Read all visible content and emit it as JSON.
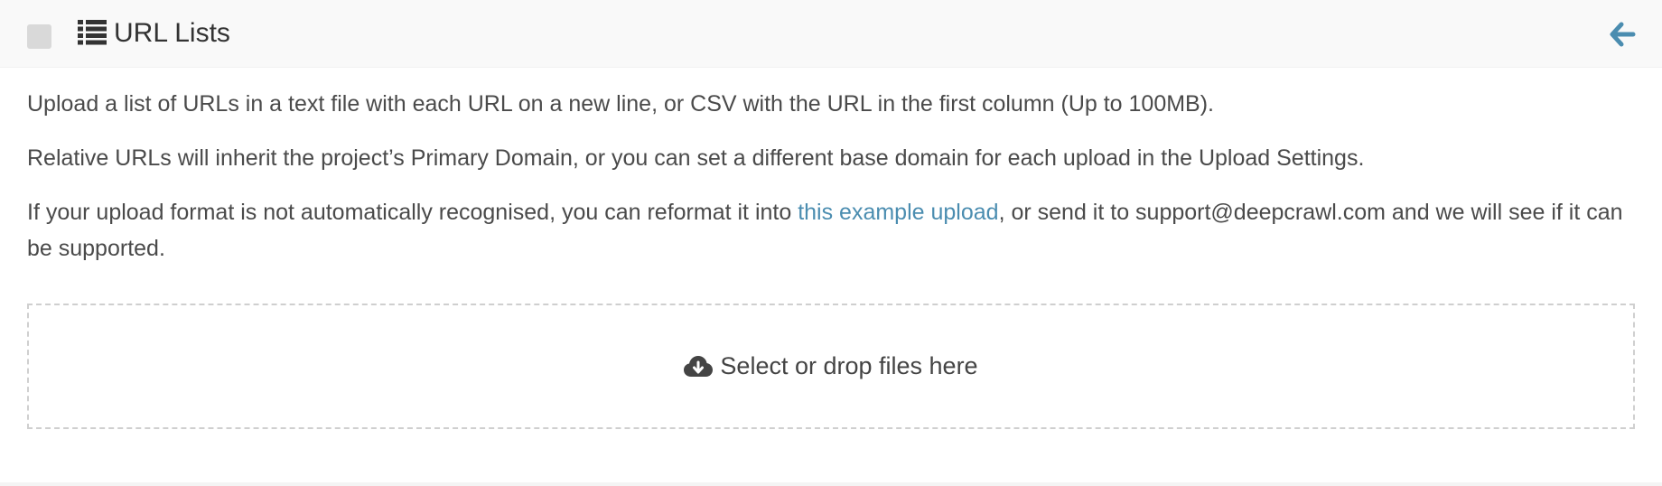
{
  "header": {
    "title": "URL Lists",
    "icons": {
      "list": "list-icon",
      "back": "arrow-left-icon",
      "checkbox": "checkbox"
    },
    "accent_color": "#4b8db0"
  },
  "body": {
    "paragraph1": "Upload a list of URLs in a text file with each URL on a new line, or CSV with the URL in the first column (Up to 100MB).",
    "paragraph2": "Relative URLs will inherit the project’s Primary Domain, or you can set a different base domain for each upload in the Upload Settings.",
    "paragraph3_before": "If your upload format is not automatically recognised, you can reformat it into ",
    "paragraph3_link": "this example upload",
    "paragraph3_after": ", or send it to support@deepcrawl.com and we will see if it can be supported."
  },
  "dropzone": {
    "label": "Select or drop files here",
    "icon": "cloud-download-icon"
  }
}
